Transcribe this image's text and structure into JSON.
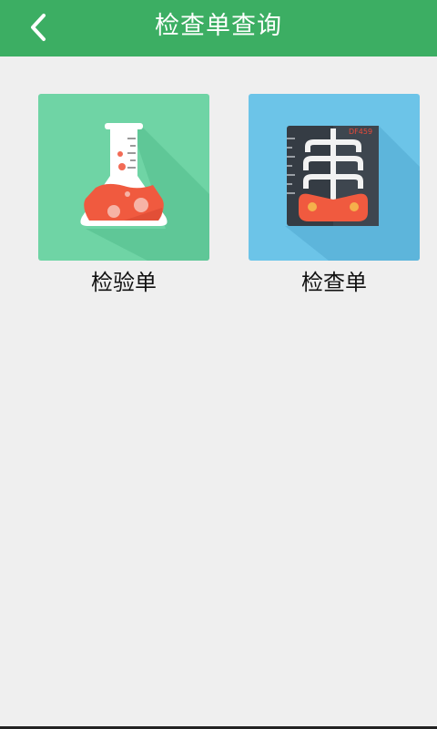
{
  "header": {
    "title": "检查单查询",
    "back_icon": "chevron-left-icon",
    "color": "#3cae63"
  },
  "cards": [
    {
      "label": "检验单",
      "icon": "flask-icon",
      "tile_color": "#6fd4a5"
    },
    {
      "label": "检查单",
      "icon": "xray-film-icon",
      "tile_color": "#6cc4e8"
    }
  ],
  "xray": {
    "film_code": "DF459"
  }
}
